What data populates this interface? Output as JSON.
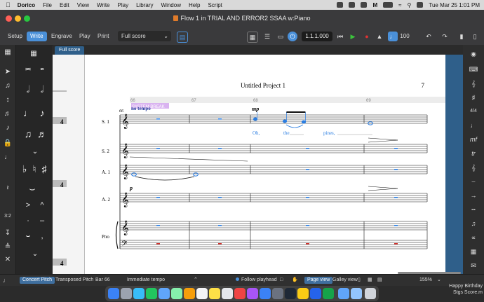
{
  "menubar": {
    "app_name": "Dorico",
    "items": [
      "File",
      "Edit",
      "View",
      "Write",
      "Play",
      "Library",
      "Window",
      "Help",
      "Script"
    ],
    "clock": "Tue Mar 25  1:01 PM"
  },
  "window": {
    "title": "Flow 1 in TRIAL AND ERROR2 SSAA w:Piano"
  },
  "toolbar": {
    "modes": [
      "Setup",
      "Write",
      "Engrave",
      "Play",
      "Print"
    ],
    "active_mode": "Write",
    "layout_select": "Full score",
    "timecode": "1.1.1.000",
    "tempo_value": "100"
  },
  "tabs": {
    "full_score": "Full score"
  },
  "score": {
    "project_title": "Untitled Project 1",
    "page_number": "7",
    "bar_numbers": [
      "66",
      "67",
      "68",
      "69"
    ],
    "system_bar_number": "66",
    "text_no_tempo": "no tempo",
    "text_system_break": "SYSTEM BREAK",
    "dynamic_mp": "mp",
    "dynamic_p": "p",
    "lyrics": [
      "Oh,",
      "the",
      "pines,"
    ],
    "staff_labels": [
      "S. 1",
      "S. 2",
      "A. 1",
      "A. 2",
      "Pno"
    ]
  },
  "statusbar": {
    "concert_pitch": "Concert Pitch",
    "transposed_pitch": "Transposed Pitch",
    "bar": "Bar 66",
    "tempo_mode": "Immediate tempo",
    "follow_playhead": "Follow playhead",
    "page_view": "Page view",
    "galley_view": "Galley view",
    "zoom": "155%"
  },
  "desktop": {
    "note_line1": "Happy Birthday",
    "note_line2": "Stgs Score.m"
  },
  "colors": {
    "accent": "#4a90d9",
    "score_bg": "#2f5f8a",
    "selection_blue": "#2a7de1",
    "piano_red": "#d0312d",
    "system_break_bg": "#d9b3f0"
  }
}
